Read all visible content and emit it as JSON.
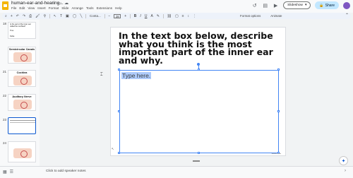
{
  "app": {
    "doc_title": "human-ear-and-hearing...",
    "menu": [
      "File",
      "Edit",
      "View",
      "Insert",
      "Format",
      "Slide",
      "Arrange",
      "Tools",
      "Extensions",
      "Help"
    ],
    "slideshow_label": "Slideshow",
    "share_label": "Share",
    "accent": "#0b57d0"
  },
  "toolbar": {
    "font_name": "Conta...",
    "font_size": "28",
    "format_options_label": "Format options",
    "animate_label": "Animate"
  },
  "filmstrip": {
    "slides": [
      {
        "num": "18",
        "title": "",
        "text": "Is the part of the inner ear called the cochlea?",
        "answers": [
          "True",
          "False"
        ]
      },
      {
        "num": "",
        "title": "Semicircular Canals",
        "text": ""
      },
      {
        "num": "21",
        "title": "Cochlea",
        "text": ""
      },
      {
        "num": "22",
        "title": "Auditory Nerve",
        "text": ""
      },
      {
        "num": "23",
        "title": "",
        "text": "",
        "selected": true
      },
      {
        "num": "24",
        "title": "",
        "text": ""
      }
    ]
  },
  "slide": {
    "heading": "In the text box below, describe what you think is the most important part of the inner ear and why.",
    "textbox_placeholder": "Type here."
  },
  "notes": {
    "placeholder": "Click to add speaker notes"
  }
}
